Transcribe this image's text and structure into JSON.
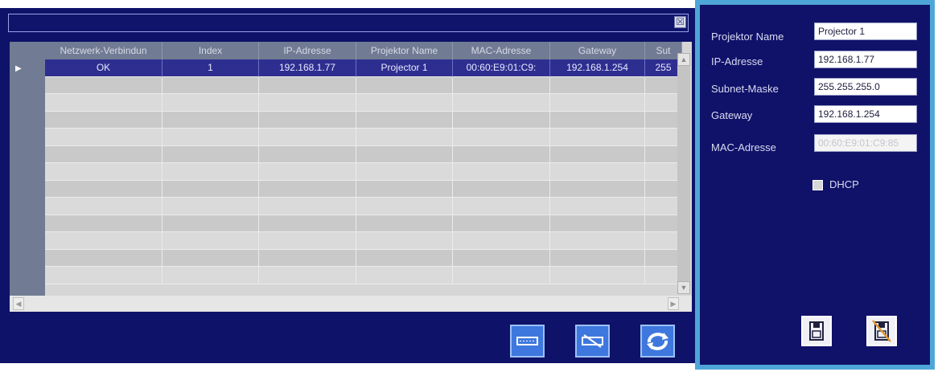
{
  "table": {
    "columns": [
      "Netzwerk-Verbindun",
      "Index",
      "IP-Adresse",
      "Projektor Name",
      "MAC-Adresse",
      "Gateway",
      "Sut"
    ],
    "rows": [
      [
        "OK",
        "1",
        "192.168.1.77",
        "Projector 1",
        "00:60:E9:01:C9:",
        "192.168.1.254",
        "255"
      ]
    ],
    "selected_marker": "▶"
  },
  "dialog": {
    "close_symbol": "☒"
  },
  "form": {
    "projector_name_label": "Projektor Name",
    "projector_name_value": "Projector 1",
    "ip_label": "IP-Adresse",
    "ip_value": "192.168.1.77",
    "subnet_label": "Subnet-Maske",
    "subnet_value": "255.255.255.0",
    "gateway_label": "Gateway",
    "gateway_value": "192.168.1.254",
    "mac_label": "MAC-Adresse",
    "mac_value": "00:60:E9:01:C9:85",
    "dhcp_label": "DHCP",
    "dhcp_checked": false
  },
  "icons": {
    "bottom_buttons": [
      "projector-icon",
      "projector-remove-icon",
      "refresh-icon"
    ],
    "form_buttons": [
      "save-icon",
      "cancel-save-icon"
    ]
  },
  "colors": {
    "panel_bg": "#0e1268",
    "selected_row": "#2e2e90",
    "accent_border": "#4ea6d8",
    "tool_button": "#3e78de"
  }
}
